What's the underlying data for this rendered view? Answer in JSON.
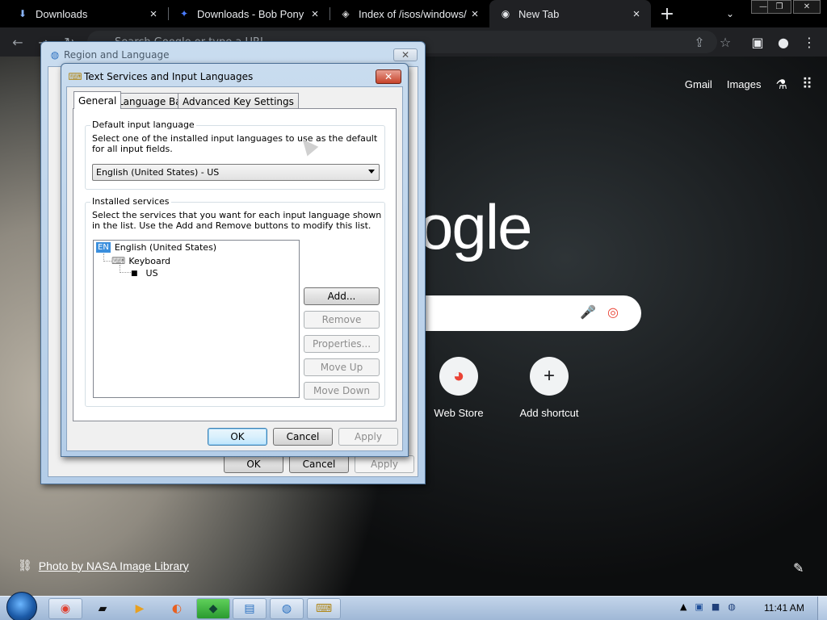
{
  "browser": {
    "tabs": [
      {
        "title": "Downloads",
        "icon": "download-icon"
      },
      {
        "title": "Downloads - Bob Pony",
        "icon": "bobpony-icon"
      },
      {
        "title": "Index of /isos/windows/",
        "icon": "globe-icon"
      },
      {
        "title": "New Tab",
        "icon": "chrome-icon",
        "active": true
      }
    ],
    "omnibox_placeholder": "Search Google or type a URL"
  },
  "ntp": {
    "links": [
      "Gmail",
      "Images"
    ],
    "logo_fragment": "ogle",
    "shortcuts": [
      {
        "label": "Web Store",
        "icon": "chrome-webstore-icon"
      },
      {
        "label": "Add shortcut",
        "icon": "plus-icon"
      }
    ],
    "credit": "Photo by NASA Image Library"
  },
  "region_dialog": {
    "title": "Region and Language",
    "ok": "OK",
    "cancel": "Cancel",
    "apply": "Apply"
  },
  "text_services_dialog": {
    "title": "Text Services and Input Languages",
    "tabs": [
      "General",
      "Language Bar",
      "Advanced Key Settings"
    ],
    "default_input": {
      "label": "Default input language",
      "description": "Select one of the installed input languages to use as the default for all input fields.",
      "selected": "English (United States) - US"
    },
    "installed_services": {
      "label": "Installed services",
      "description": "Select the services that you want for each input language shown in the list. Use the Add and Remove buttons to modify this list.",
      "language_badge": "EN",
      "language": "English (United States)",
      "category": "Keyboard",
      "layout": "US"
    },
    "buttons": {
      "add": "Add...",
      "remove": "Remove",
      "properties": "Properties...",
      "move_up": "Move Up",
      "move_down": "Move Down"
    },
    "ok": "OK",
    "cancel": "Cancel",
    "apply": "Apply"
  },
  "taskbar": {
    "clock": "11:41 AM"
  }
}
